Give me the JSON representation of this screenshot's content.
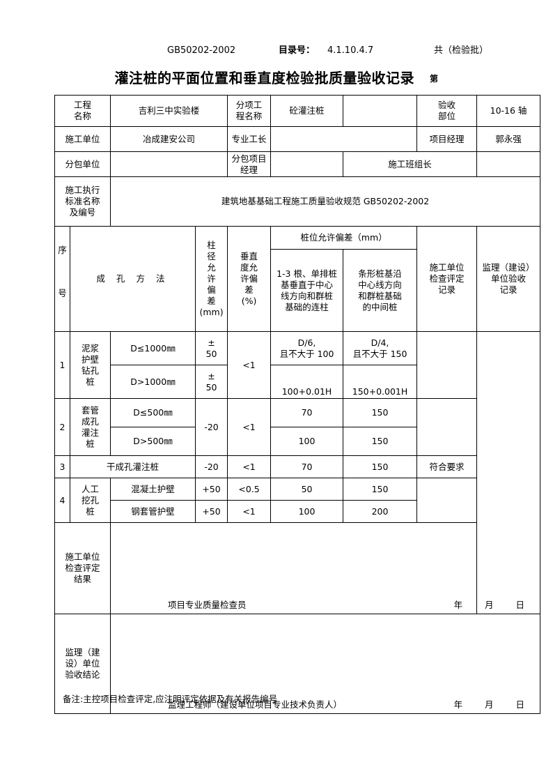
{
  "header": {
    "standard_code": "GB50202-2002",
    "catalog_label": "目录号：",
    "catalog_value": "4.1.10.4.7",
    "total_label": "共（检验批）",
    "title": "灌注桩的平面位置和垂直度检验批质量验收记录",
    "page_label": "第"
  },
  "info": {
    "project_name_label": "工程\n名称",
    "project_name_line1": "工程",
    "project_name_line2": "名称",
    "project_name_value": "吉利三中实验楼",
    "subitem_label_line1": "分项工",
    "subitem_label_line2": "程名称",
    "subitem_value": "砼灌注桩",
    "acceptance_part_label_line1": "验收",
    "acceptance_part_label_line2": "部位",
    "acceptance_part_value": "10-16 轴",
    "construction_unit_label": "施工单位",
    "construction_unit_value": "冶成建安公司",
    "foreman_label": "专业工长",
    "foreman_value": "",
    "project_manager_label": "项目经理",
    "project_manager_value": "郭永强",
    "subcontractor_label": "分包单位",
    "subcontractor_value": "",
    "sub_project_manager_label": "分包项目经理",
    "sub_project_manager_value": "",
    "team_leader_label": "施工班组长",
    "team_leader_value": "",
    "standard_label_line1": "施工执行",
    "standard_label_line2": "标准名称",
    "standard_label_line3": "及编号",
    "standard_value": "建筑地基基础工程施工质量验收规范  GB50202-2002"
  },
  "table_headers": {
    "seq_c1": "序",
    "seq_c2": "号",
    "method": "成 孔 方 法",
    "diameter_dev_chars": [
      "柱",
      "径",
      "允",
      "许",
      "偏",
      "差",
      "(mm)"
    ],
    "verticality_lines": [
      "垂直",
      "度允",
      "许偏",
      "差",
      "(%)"
    ],
    "pile_pos_group": "桩位允许偏差（mm）",
    "pile_pos_col1_lines": [
      "1-3 根、单排桩",
      "基垂直于中心",
      "线方向和群桩",
      "基础的连柱"
    ],
    "pile_pos_col2_lines": [
      "条形桩基沿",
      "中心线方向",
      "和群桩基础",
      "的中间桩"
    ],
    "constructor_record_lines": [
      "施工单位",
      "检查评定",
      "记录"
    ],
    "supervisor_record_lines": [
      "监理（建设）",
      "单位验收",
      "记录"
    ]
  },
  "rows": [
    {
      "no": "1",
      "type_lines": [
        "泥浆",
        "护壁",
        "钻孔",
        "桩"
      ],
      "sub": [
        {
          "method": "D≤1000㎜",
          "diameter": "±\n50",
          "diameter_l1": "±",
          "diameter_l2": "50",
          "pos1_l1": "D/6,",
          "pos1_l2": "且不大于 100",
          "pos2_l1": "D/4,",
          "pos2_l2": "且不大于 150"
        },
        {
          "method": "D>1000㎜",
          "diameter_l1": "±",
          "diameter_l2": "50",
          "pos1_l1": "",
          "pos1_l2": "100+0.01H",
          "pos2_l1": "",
          "pos2_l2": "150+0.001H"
        }
      ],
      "verticality": "<1",
      "constructor_record": "",
      "diameter_merged": false
    },
    {
      "no": "2",
      "type_lines": [
        "套管",
        "成孔",
        "灌注",
        "桩"
      ],
      "sub": [
        {
          "method": "D≤500㎜",
          "pos1_l2": "70",
          "pos2_l2": "150"
        },
        {
          "method": "D>500㎜",
          "pos1_l2": "100",
          "pos2_l2": "150"
        }
      ],
      "verticality": "<1",
      "diameter": "-20",
      "constructor_record": "",
      "diameter_merged": true
    },
    {
      "no": "3",
      "type_lines": [],
      "single_method": "干成孔灌注桩",
      "diameter": "-20",
      "verticality": "<1",
      "pos1": "70",
      "pos2": "150",
      "constructor_record": "符合要求"
    },
    {
      "no": "4",
      "type_lines": [
        "人工",
        "挖孔",
        "桩"
      ],
      "sub": [
        {
          "method": "混凝土护壁",
          "diameter": "+50",
          "verticality": "<0.5",
          "pos1_l2": "50",
          "pos2_l2": "150"
        },
        {
          "method": "钢套管护壁",
          "diameter": "+50",
          "verticality": "<1",
          "pos1_l2": "100",
          "pos2_l2": "200"
        }
      ],
      "constructor_record": "",
      "diameter_merged": false
    }
  ],
  "conclusions": {
    "constructor_label_lines": [
      "施工单位",
      "检查评定",
      "结果"
    ],
    "constructor_body": "",
    "constructor_signer": "项目专业质量检查员",
    "constructor_date": "年  月  日",
    "supervisor_label_lines": [
      "监理（建",
      "设）单位",
      "验收结论"
    ],
    "supervisor_body": "",
    "supervisor_signer": "监理工程师（建设单位项目专业技术负责人）",
    "supervisor_date": "年  月  日"
  },
  "remark": "备注:主控项目检查评定,应注明评定依据及有关报告编号"
}
